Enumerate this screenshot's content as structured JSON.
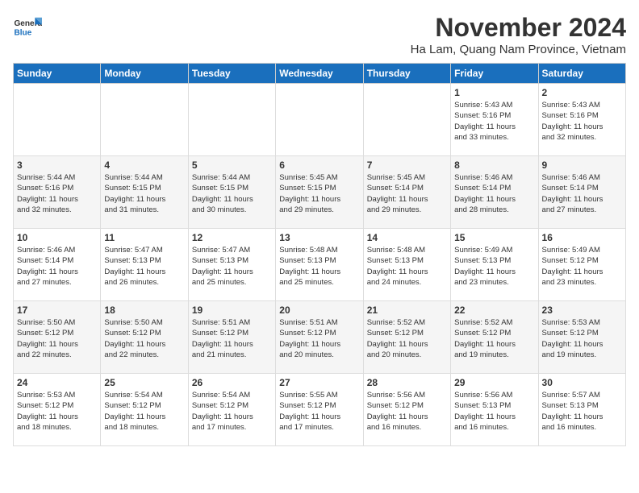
{
  "logo": {
    "line1": "General",
    "line2": "Blue"
  },
  "title": "November 2024",
  "location": "Ha Lam, Quang Nam Province, Vietnam",
  "weekdays": [
    "Sunday",
    "Monday",
    "Tuesday",
    "Wednesday",
    "Thursday",
    "Friday",
    "Saturday"
  ],
  "weeks": [
    [
      {
        "day": "",
        "info": ""
      },
      {
        "day": "",
        "info": ""
      },
      {
        "day": "",
        "info": ""
      },
      {
        "day": "",
        "info": ""
      },
      {
        "day": "",
        "info": ""
      },
      {
        "day": "1",
        "info": "Sunrise: 5:43 AM\nSunset: 5:16 PM\nDaylight: 11 hours\nand 33 minutes."
      },
      {
        "day": "2",
        "info": "Sunrise: 5:43 AM\nSunset: 5:16 PM\nDaylight: 11 hours\nand 32 minutes."
      }
    ],
    [
      {
        "day": "3",
        "info": "Sunrise: 5:44 AM\nSunset: 5:16 PM\nDaylight: 11 hours\nand 32 minutes."
      },
      {
        "day": "4",
        "info": "Sunrise: 5:44 AM\nSunset: 5:15 PM\nDaylight: 11 hours\nand 31 minutes."
      },
      {
        "day": "5",
        "info": "Sunrise: 5:44 AM\nSunset: 5:15 PM\nDaylight: 11 hours\nand 30 minutes."
      },
      {
        "day": "6",
        "info": "Sunrise: 5:45 AM\nSunset: 5:15 PM\nDaylight: 11 hours\nand 29 minutes."
      },
      {
        "day": "7",
        "info": "Sunrise: 5:45 AM\nSunset: 5:14 PM\nDaylight: 11 hours\nand 29 minutes."
      },
      {
        "day": "8",
        "info": "Sunrise: 5:46 AM\nSunset: 5:14 PM\nDaylight: 11 hours\nand 28 minutes."
      },
      {
        "day": "9",
        "info": "Sunrise: 5:46 AM\nSunset: 5:14 PM\nDaylight: 11 hours\nand 27 minutes."
      }
    ],
    [
      {
        "day": "10",
        "info": "Sunrise: 5:46 AM\nSunset: 5:14 PM\nDaylight: 11 hours\nand 27 minutes."
      },
      {
        "day": "11",
        "info": "Sunrise: 5:47 AM\nSunset: 5:13 PM\nDaylight: 11 hours\nand 26 minutes."
      },
      {
        "day": "12",
        "info": "Sunrise: 5:47 AM\nSunset: 5:13 PM\nDaylight: 11 hours\nand 25 minutes."
      },
      {
        "day": "13",
        "info": "Sunrise: 5:48 AM\nSunset: 5:13 PM\nDaylight: 11 hours\nand 25 minutes."
      },
      {
        "day": "14",
        "info": "Sunrise: 5:48 AM\nSunset: 5:13 PM\nDaylight: 11 hours\nand 24 minutes."
      },
      {
        "day": "15",
        "info": "Sunrise: 5:49 AM\nSunset: 5:13 PM\nDaylight: 11 hours\nand 23 minutes."
      },
      {
        "day": "16",
        "info": "Sunrise: 5:49 AM\nSunset: 5:12 PM\nDaylight: 11 hours\nand 23 minutes."
      }
    ],
    [
      {
        "day": "17",
        "info": "Sunrise: 5:50 AM\nSunset: 5:12 PM\nDaylight: 11 hours\nand 22 minutes."
      },
      {
        "day": "18",
        "info": "Sunrise: 5:50 AM\nSunset: 5:12 PM\nDaylight: 11 hours\nand 22 minutes."
      },
      {
        "day": "19",
        "info": "Sunrise: 5:51 AM\nSunset: 5:12 PM\nDaylight: 11 hours\nand 21 minutes."
      },
      {
        "day": "20",
        "info": "Sunrise: 5:51 AM\nSunset: 5:12 PM\nDaylight: 11 hours\nand 20 minutes."
      },
      {
        "day": "21",
        "info": "Sunrise: 5:52 AM\nSunset: 5:12 PM\nDaylight: 11 hours\nand 20 minutes."
      },
      {
        "day": "22",
        "info": "Sunrise: 5:52 AM\nSunset: 5:12 PM\nDaylight: 11 hours\nand 19 minutes."
      },
      {
        "day": "23",
        "info": "Sunrise: 5:53 AM\nSunset: 5:12 PM\nDaylight: 11 hours\nand 19 minutes."
      }
    ],
    [
      {
        "day": "24",
        "info": "Sunrise: 5:53 AM\nSunset: 5:12 PM\nDaylight: 11 hours\nand 18 minutes."
      },
      {
        "day": "25",
        "info": "Sunrise: 5:54 AM\nSunset: 5:12 PM\nDaylight: 11 hours\nand 18 minutes."
      },
      {
        "day": "26",
        "info": "Sunrise: 5:54 AM\nSunset: 5:12 PM\nDaylight: 11 hours\nand 17 minutes."
      },
      {
        "day": "27",
        "info": "Sunrise: 5:55 AM\nSunset: 5:12 PM\nDaylight: 11 hours\nand 17 minutes."
      },
      {
        "day": "28",
        "info": "Sunrise: 5:56 AM\nSunset: 5:12 PM\nDaylight: 11 hours\nand 16 minutes."
      },
      {
        "day": "29",
        "info": "Sunrise: 5:56 AM\nSunset: 5:13 PM\nDaylight: 11 hours\nand 16 minutes."
      },
      {
        "day": "30",
        "info": "Sunrise: 5:57 AM\nSunset: 5:13 PM\nDaylight: 11 hours\nand 16 minutes."
      }
    ]
  ]
}
